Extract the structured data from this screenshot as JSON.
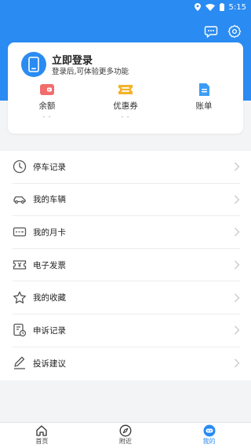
{
  "status_bar": {
    "time": "5:15"
  },
  "header": {
    "icons": [
      "chat-icon",
      "settings-icon"
    ]
  },
  "profile": {
    "title": "立即登录",
    "subtitle": "登录后,可体验更多功能",
    "stats": [
      {
        "label": "余额",
        "value": "- -",
        "icon": "wallet-icon"
      },
      {
        "label": "优惠券",
        "value": "- -",
        "icon": "coupon-icon"
      },
      {
        "label": "账单",
        "value": "",
        "icon": "bill-icon"
      }
    ]
  },
  "menu": {
    "items": [
      {
        "label": "停车记录",
        "icon": "clock-icon"
      },
      {
        "label": "我的车辆",
        "icon": "car-icon"
      },
      {
        "label": "我的月卡",
        "icon": "card-icon"
      },
      {
        "label": "电子发票",
        "icon": "invoice-icon"
      },
      {
        "label": "我的收藏",
        "icon": "star-icon"
      },
      {
        "label": "申诉记录",
        "icon": "appeal-record-icon"
      },
      {
        "label": "投诉建议",
        "icon": "pencil-icon"
      }
    ]
  },
  "tabbar": {
    "tabs": [
      {
        "label": "首页",
        "icon": "home-icon",
        "active": false
      },
      {
        "label": "附近",
        "icon": "compass-icon",
        "active": false
      },
      {
        "label": "我的",
        "icon": "robot-face-icon",
        "active": true
      }
    ]
  },
  "colors": {
    "primary": "#2a8bf2",
    "wallet": "#f26c6c",
    "coupon": "#f5b32a",
    "bill": "#3b9cf6"
  }
}
